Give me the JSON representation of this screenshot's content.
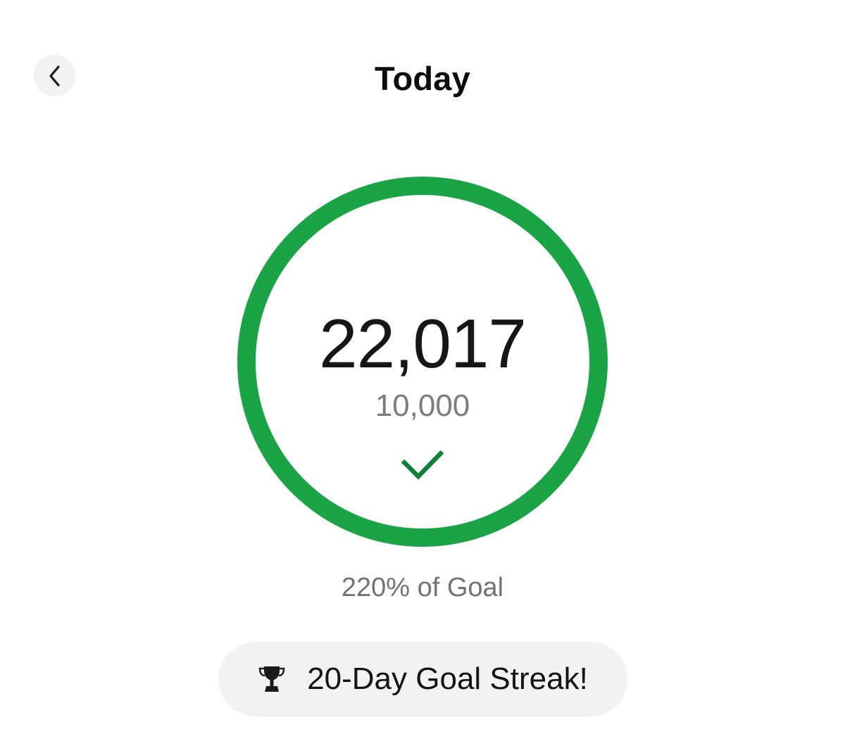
{
  "header": {
    "title": "Today",
    "back_icon": "chevron-left-icon"
  },
  "progress": {
    "steps": "22,017",
    "goal": "10,000",
    "percent_label": "220% of Goal",
    "progress_fraction": 2.2,
    "ring_color": "#1aa445",
    "check_color": "#0f7f3b",
    "check_icon": "checkmark-icon"
  },
  "streak": {
    "label": "20-Day Goal Streak!",
    "icon": "trophy-icon",
    "background": "#f2f2f2"
  }
}
